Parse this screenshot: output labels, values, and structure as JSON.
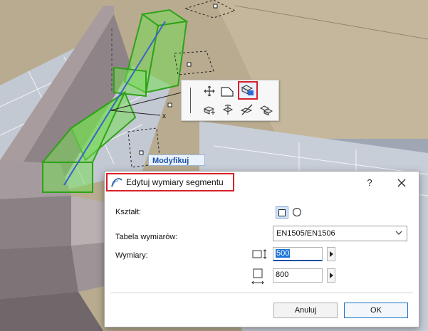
{
  "canvas": {
    "axis_label": "x",
    "modify_label": "Modyfikuj"
  },
  "pet_palette": {
    "items": [
      "move-icon",
      "drag-corner-icon",
      "edit-segment-size-icon",
      "offset-icon",
      "rotate-icon",
      "split-icon",
      "duplicate-icon"
    ],
    "active_item": "edit-segment-size-icon"
  },
  "dialog": {
    "title": "Edytuj wymiary segmentu",
    "help_label": "?",
    "close_label": "✕",
    "shape_label": "Kształt:",
    "shape_options": [
      "rectangular-icon",
      "circular-icon"
    ],
    "shape_selected": "rectangular-icon",
    "table_label": "Tabela wymiarów:",
    "table_value": "EN1505/EN1506",
    "dimensions_label": "Wymiary:",
    "width_value": "500",
    "height_value": "800",
    "cancel_label": "Anuluj",
    "ok_label": "OK"
  },
  "colors": {
    "highlight_red": "#d8202a",
    "selection_green": "#3fcc22",
    "accent_blue": "#1b52a6"
  }
}
